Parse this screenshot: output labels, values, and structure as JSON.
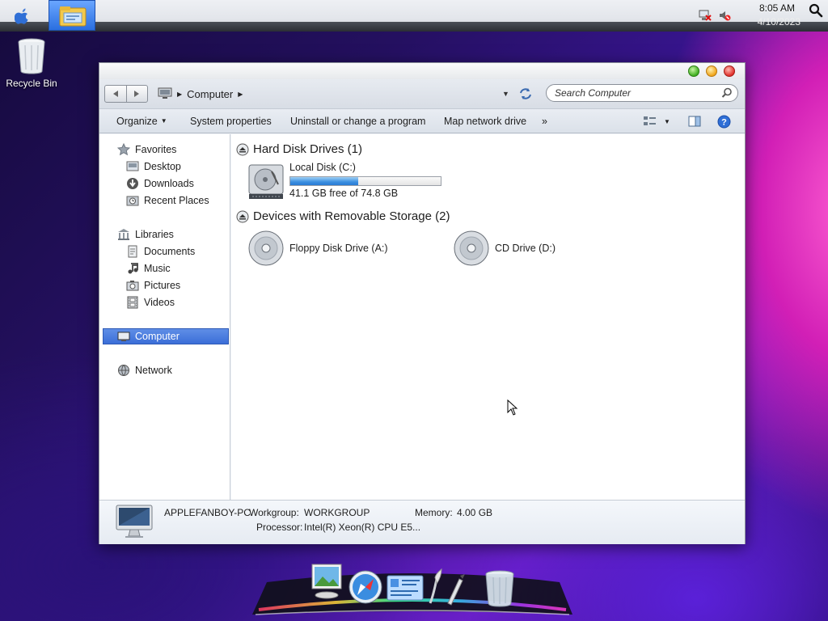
{
  "menubar": {
    "time": "8:05 AM",
    "date": "4/10/2023",
    "icons": [
      "apple-icon",
      "file-explorer-icon",
      "network-disconnected-icon",
      "volume-muted-icon",
      "spotlight-search-icon"
    ]
  },
  "desktop": {
    "icons": [
      {
        "label": "Recycle Bin",
        "icon": "recycle-bin-icon"
      }
    ]
  },
  "window": {
    "address": {
      "crumbs": [
        "Computer"
      ],
      "search_placeholder": "Search Computer"
    },
    "commandbar": {
      "organize": "Organize",
      "system_properties": "System properties",
      "uninstall": "Uninstall or change a program",
      "map_drive": "Map network drive",
      "more": "»"
    },
    "nav": {
      "favorites": {
        "label": "Favorites",
        "items": [
          "Desktop",
          "Downloads",
          "Recent Places"
        ]
      },
      "libraries": {
        "label": "Libraries",
        "items": [
          "Documents",
          "Music",
          "Pictures",
          "Videos"
        ]
      },
      "computer": "Computer",
      "network": "Network"
    },
    "groups": {
      "hard_disks": {
        "title": "Hard Disk Drives (1)",
        "drives": [
          {
            "name": "Local Disk (C:)",
            "free_text": "41.1 GB free of 74.8 GB",
            "used_fraction": 0.45
          }
        ]
      },
      "removable": {
        "title": "Devices with Removable Storage (2)",
        "drives": [
          {
            "name": "Floppy Disk Drive (A:)"
          },
          {
            "name": "CD Drive (D:)"
          }
        ]
      }
    },
    "details": {
      "pc_name": "APPLEFANBOY-PC",
      "workgroup_label": "Workgroup:",
      "workgroup_value": "WORKGROUP",
      "memory_label": "Memory:",
      "memory_value": "4.00 GB",
      "processor_label": "Processor:",
      "processor_value": "Intel(R) Xeon(R) CPU E5..."
    }
  },
  "dock": {
    "icons": [
      "photo-viewer-icon",
      "safari-icon",
      "settings-panel-icon",
      "quill-pen-icon",
      "trash-icon"
    ]
  },
  "colors": {
    "selection": "#3b6ed8",
    "progress": "#3b8fe0"
  }
}
